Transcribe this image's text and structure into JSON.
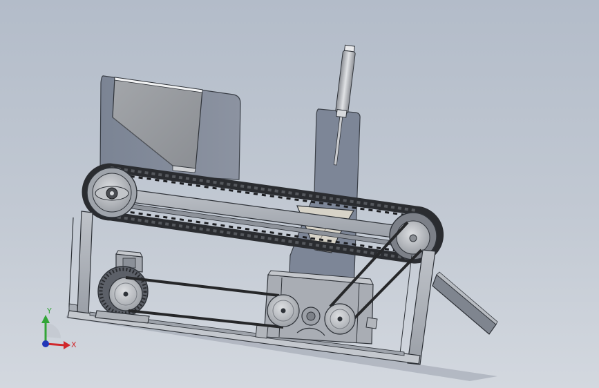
{
  "viewport": {
    "background_top": "#b3bcc9",
    "background_bottom": "#d3d8df"
  },
  "model": {
    "components": [
      "hopper",
      "rear-frame-plate",
      "front-frame-plate",
      "pneumatic-cylinder",
      "crawler-track",
      "drive-sprocket",
      "idler-sprocket",
      "track-frame-bar",
      "chute",
      "base-frame",
      "electric-motor",
      "motor-pulley",
      "v-belt",
      "gearbox",
      "gearbox-input-pulley",
      "gearbox-output-pulley",
      "discharge-ramp"
    ],
    "colors": {
      "plate": "#858d9c",
      "hopper": "#9a9da2",
      "track": "#2a2c30",
      "frame": "#a8adb5",
      "pulley": "#b4b7bc",
      "belt": "#262729"
    }
  },
  "triad": {
    "x_label": "X",
    "y_label": "Y",
    "x_color": "#d0282c",
    "y_color": "#32a537",
    "z_color": "#2236b8"
  }
}
